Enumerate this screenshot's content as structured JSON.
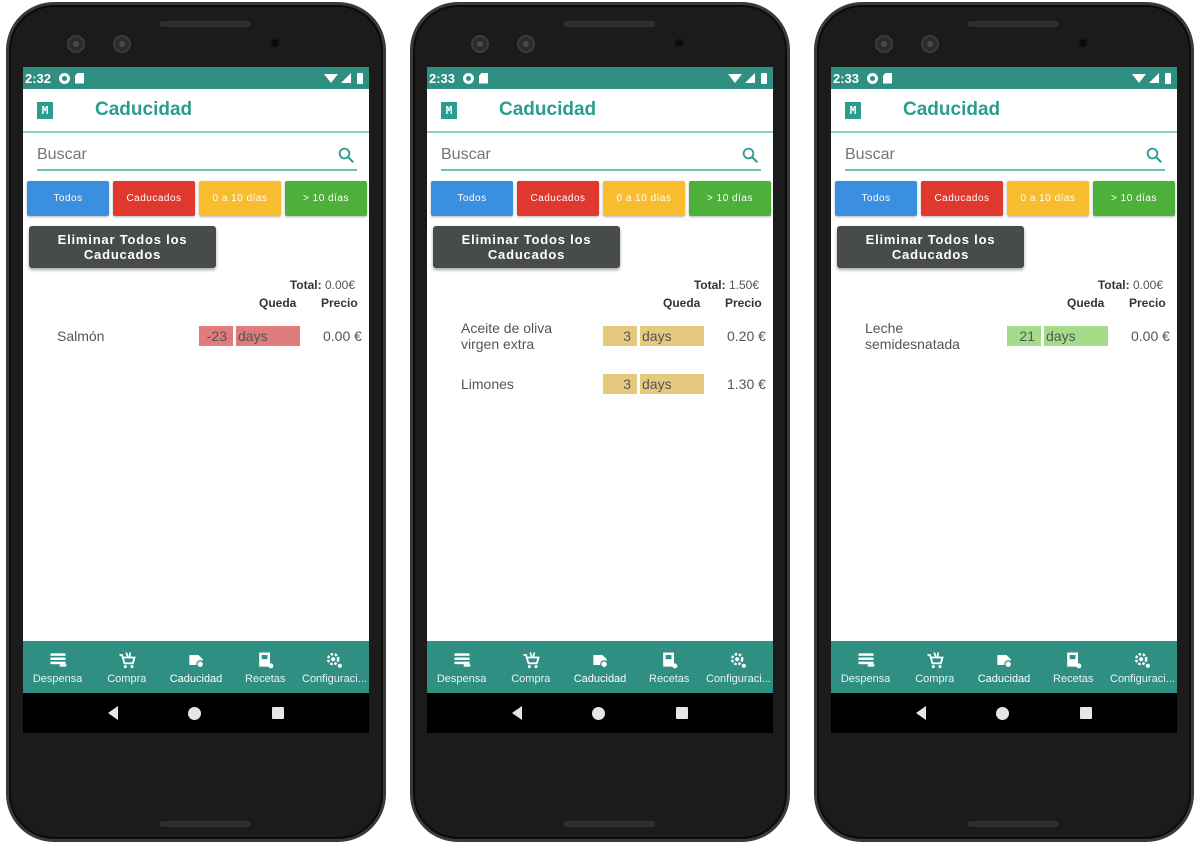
{
  "app": {
    "title": "Caducidad",
    "logo_letter": "M",
    "search_placeholder": "Buscar",
    "filters": [
      {
        "label": "Todos",
        "color": "#3b8fe0"
      },
      {
        "label": "Caducados",
        "color": "#e0372e"
      },
      {
        "label": "0 a 10 días",
        "color": "#f7bd2e"
      },
      {
        "label": "> 10 días",
        "color": "#4db03a"
      }
    ],
    "delete_button_line1": "Eliminar Todos los",
    "delete_button_line2": "Caducados",
    "total_label": "Total:",
    "col_queda": "Queda",
    "col_precio": "Precio",
    "nav": [
      {
        "label": "Despensa",
        "icon": "list-icon"
      },
      {
        "label": "Compra",
        "icon": "cart-icon"
      },
      {
        "label": "Caducidad",
        "icon": "expiry-icon"
      },
      {
        "label": "Recetas",
        "icon": "recipes-icon"
      },
      {
        "label": "Configuraci...",
        "icon": "settings-icon"
      }
    ],
    "status_color": "#2f8f83",
    "accent": "#2a9d8f"
  },
  "screens": [
    {
      "time": "2:32",
      "total": "0.00€",
      "items": [
        {
          "name": "Salmón",
          "days": "-23",
          "unit": "days",
          "price": "0.00  €",
          "color": "#e07b7b"
        }
      ]
    },
    {
      "time": "2:33",
      "total": "1.50€",
      "items": [
        {
          "name": "Aceite de oliva virgen extra",
          "days": "3",
          "unit": "days",
          "price": "0.20  €",
          "color": "#e5c97d"
        },
        {
          "name": "Limones",
          "days": "3",
          "unit": "days",
          "price": "1.30  €",
          "color": "#e5c97d"
        }
      ]
    },
    {
      "time": "2:33",
      "total": "0.00€",
      "items": [
        {
          "name": "Leche semidesnatada",
          "days": "21",
          "unit": "days",
          "price": "0.00  €",
          "color": "#a5dc8a"
        }
      ]
    }
  ]
}
